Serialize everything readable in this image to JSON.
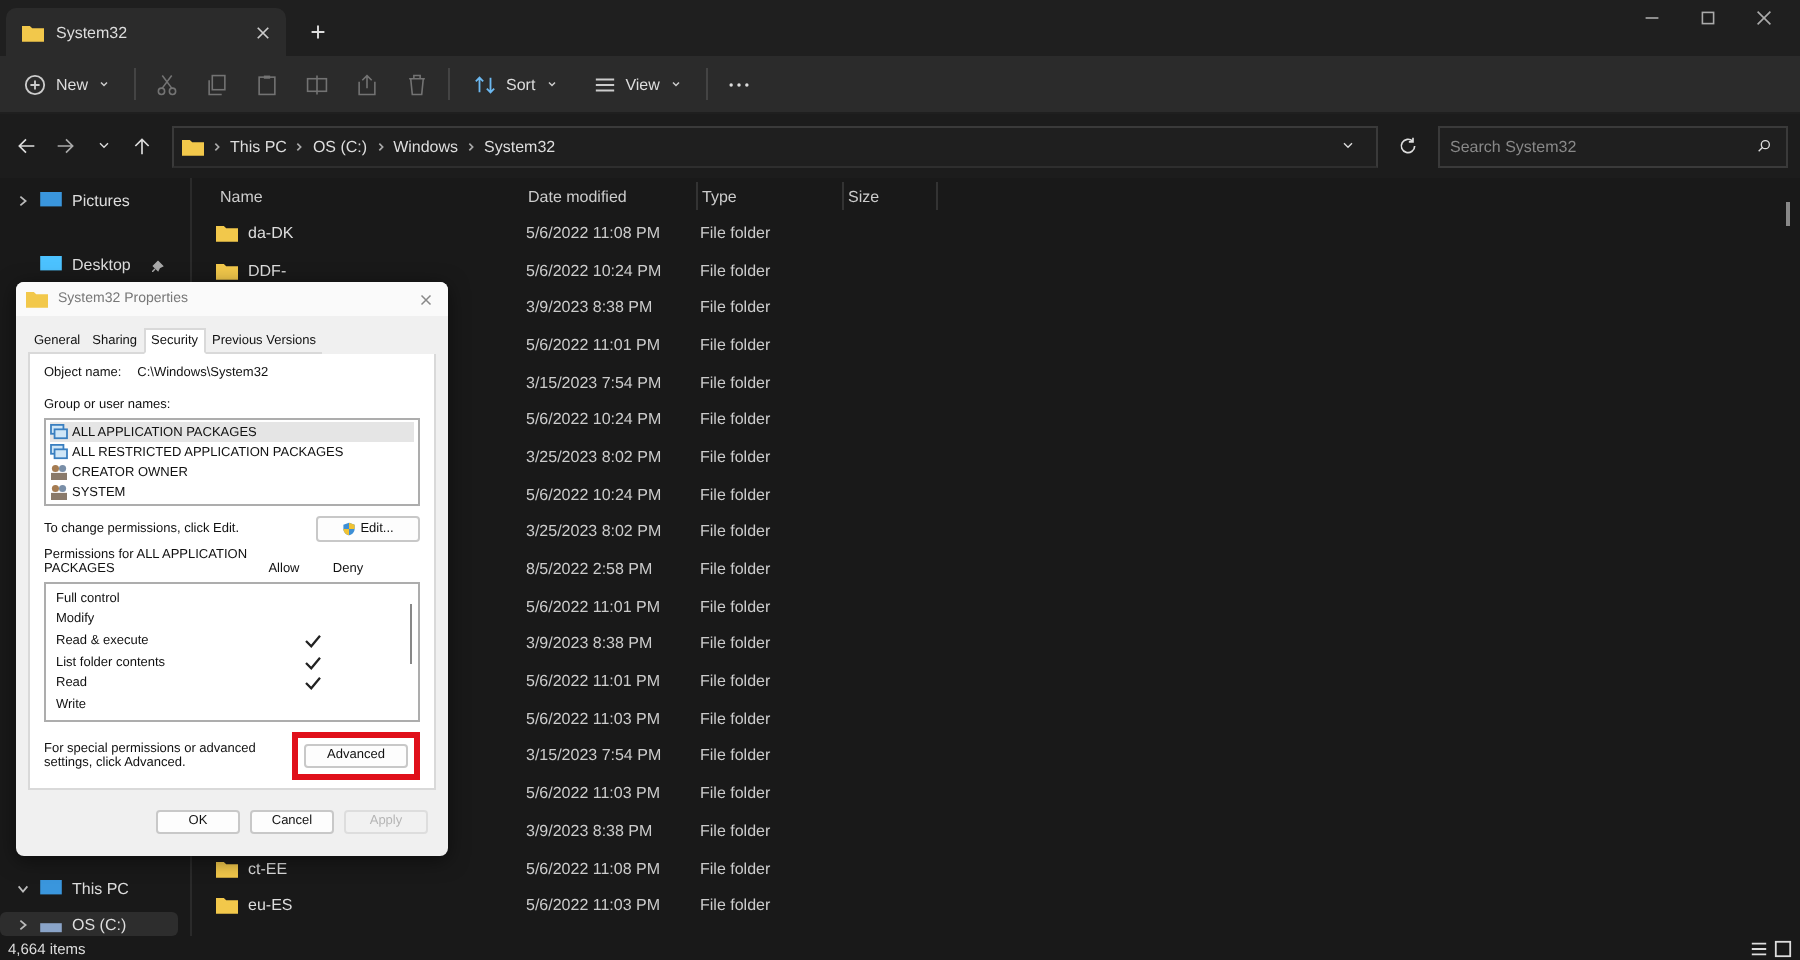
{
  "window": {
    "tab_title": "System32"
  },
  "toolbar": [
    {
      "kind": "new",
      "label": "New",
      "disabled": false
    },
    {
      "kind": "cut",
      "disabled": true
    },
    {
      "kind": "copy",
      "disabled": true
    },
    {
      "kind": "paste",
      "disabled": true
    },
    {
      "kind": "rename",
      "disabled": true
    },
    {
      "kind": "share",
      "disabled": true
    },
    {
      "kind": "delete",
      "disabled": true
    },
    {
      "kind": "sort",
      "label": "Sort",
      "disabled": false
    },
    {
      "kind": "view",
      "label": "View",
      "disabled": false
    },
    {
      "kind": "more",
      "disabled": false
    }
  ],
  "address": {
    "crumbs": [
      "This PC",
      "OS (C:)",
      "Windows",
      "System32"
    ],
    "search": {
      "placeholder": "Search System32"
    }
  },
  "sidebar": {
    "items": [
      {
        "label": "Pictures",
        "kind": "pictures",
        "expanded": false,
        "pinned": false,
        "selected": false
      },
      {
        "label": "Desktop",
        "kind": "desktop",
        "pinned": true,
        "selected": false
      },
      {
        "label": "This PC",
        "kind": "pc",
        "expanded": true,
        "pinned": false,
        "selected": false
      },
      {
        "label": "OS (C:)",
        "kind": "drive",
        "expanded": false,
        "pinned": false,
        "selected": true
      }
    ]
  },
  "table": {
    "columns": [
      "Name",
      "Date modified",
      "Type",
      "Size"
    ],
    "rows": [
      {
        "name": "da-DK",
        "date": "5/6/2022 11:08 PM",
        "type": "File folder"
      },
      {
        "name": "DDF-",
        "date": "5/6/2022 10:24 PM",
        "type": "File folder"
      },
      {
        "date": "3/9/2023 8:38 PM",
        "type": "File folder"
      },
      {
        "date": "5/6/2022 11:01 PM",
        "type": "File folder"
      },
      {
        "date": "3/15/2023 7:54 PM",
        "type": "File folder"
      },
      {
        "date": "5/6/2022 10:24 PM",
        "type": "File folder"
      },
      {
        "date": "3/25/2023 8:02 PM",
        "type": "File folder"
      },
      {
        "date": "5/6/2022 10:24 PM",
        "type": "File folder"
      },
      {
        "date": "3/25/2023 8:02 PM",
        "type": "File folder"
      },
      {
        "date": "8/5/2022 2:58 PM",
        "type": "File folder"
      },
      {
        "date": "5/6/2022 11:01 PM",
        "type": "File folder"
      },
      {
        "date": "3/9/2023 8:38 PM",
        "type": "File folder"
      },
      {
        "date": "5/6/2022 11:01 PM",
        "type": "File folder"
      },
      {
        "date": "5/6/2022 11:03 PM",
        "type": "File folder"
      },
      {
        "date": "3/15/2023 7:54 PM",
        "type": "File folder"
      },
      {
        "date": "5/6/2022 11:03 PM",
        "type": "File folder"
      },
      {
        "date": "3/9/2023 8:38 PM",
        "type": "File folder"
      },
      {
        "name": "ct-EE",
        "date": "5/6/2022 11:08 PM",
        "type": "File folder"
      },
      {
        "name": "eu-ES",
        "date": "5/6/2022 11:03 PM",
        "type": "File folder"
      }
    ]
  },
  "status_bar": {
    "count": "4,664 items"
  },
  "dialog": {
    "title": "System32 Properties",
    "tabs": [
      {
        "label": "General",
        "selected": false
      },
      {
        "label": "Sharing",
        "selected": false
      },
      {
        "label": "Security",
        "selected": true
      },
      {
        "label": "Previous Versions",
        "selected": false
      }
    ],
    "object_label": "Object name:",
    "object_value": "C:\\Windows\\System32",
    "group_label": "Group or user names:",
    "groups": [
      {
        "label": "ALL APPLICATION PACKAGES",
        "kind": "package",
        "selected": true
      },
      {
        "label": "ALL RESTRICTED APPLICATION PACKAGES",
        "kind": "package",
        "selected": false
      },
      {
        "label": "CREATOR OWNER",
        "kind": "user",
        "selected": false
      },
      {
        "label": "SYSTEM",
        "kind": "user",
        "selected": false
      }
    ],
    "change_text": "To change permissions, click Edit.",
    "edit_button": "Edit...",
    "perm_label": "Permissions for ALL APPLICATION PACKAGES",
    "allow_label": "Allow",
    "deny_label": "Deny",
    "permissions": [
      {
        "label": "Full control",
        "allow": false
      },
      {
        "label": "Modify",
        "allow": false
      },
      {
        "label": "Read & execute",
        "allow": true
      },
      {
        "label": "List folder contents",
        "allow": true
      },
      {
        "label": "Read",
        "allow": true
      },
      {
        "label": "Write",
        "allow": false
      }
    ],
    "advanced_text": "For special permissions or advanced settings, click Advanced.",
    "advanced_button": "Advanced",
    "advanced_highlighted": true,
    "buttons": [
      {
        "label": "OK",
        "disabled": false
      },
      {
        "label": "Cancel",
        "disabled": false
      },
      {
        "label": "Apply",
        "disabled": true
      }
    ]
  }
}
